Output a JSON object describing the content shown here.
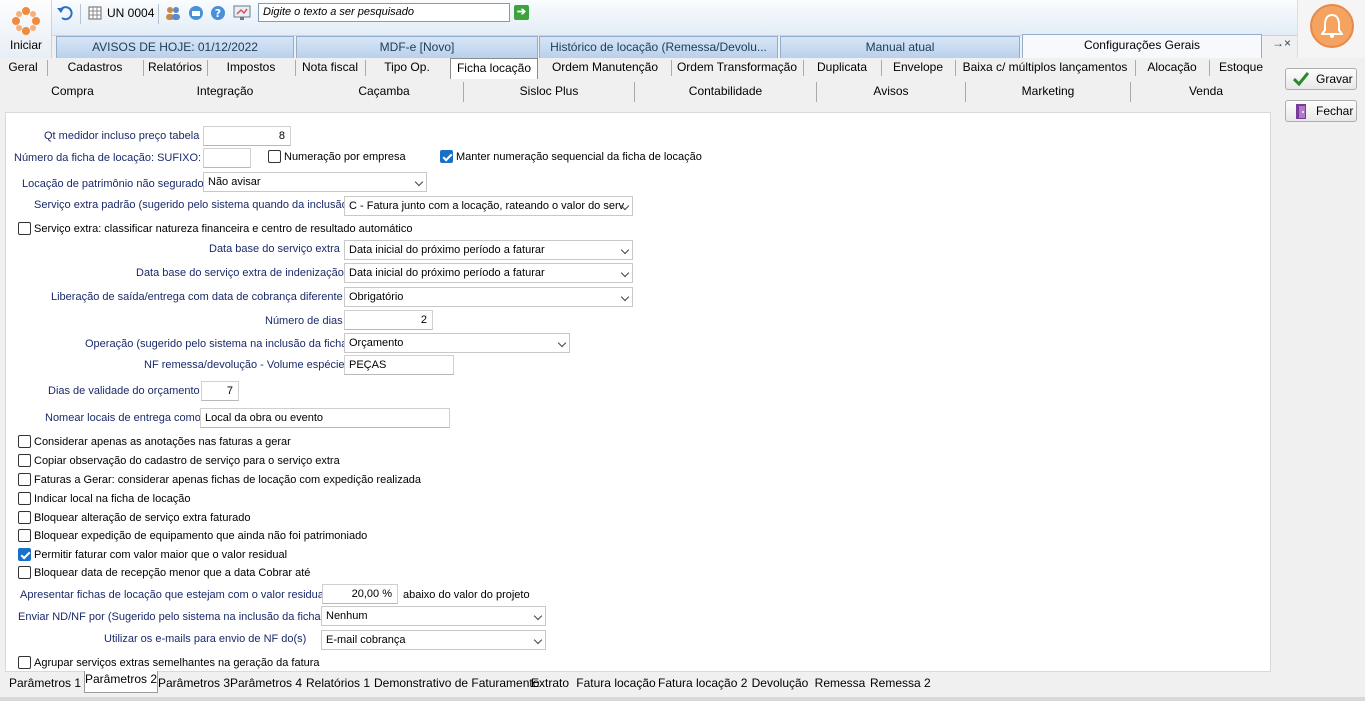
{
  "toolbar": {
    "unit": "UN 0004",
    "search_placeholder": "Digite o texto a ser pesquisado",
    "start": "Iniciar"
  },
  "doc_tabs": [
    "AVISOS DE HOJE: 01/12/2022",
    "MDF-e [Novo]",
    "Histórico de locação (Remessa/Devolu...",
    "Manual atual",
    "Configurações Gerais"
  ],
  "close_all": "→×",
  "tabs1": [
    "Geral",
    "Cadastros",
    "Relatórios",
    "Impostos",
    "Nota fiscal",
    "Tipo Op.",
    "Ficha locação",
    "Ordem Manutenção",
    "Ordem Transformação",
    "Duplicata",
    "Envelope",
    "Baixa c/ múltiplos lançamentos",
    "Alocação",
    "Estoque"
  ],
  "tabs2": [
    "Compra",
    "Integração",
    "Caçamba",
    "Sisloc Plus",
    "Contabilidade",
    "Avisos",
    "Marketing",
    "Venda"
  ],
  "buttons": {
    "save": "Gravar",
    "close": "Fechar"
  },
  "form": {
    "qt_medidor_label": "Qt medidor incluso preço tabela",
    "qt_medidor": "8",
    "numero_ficha_label": "Número da ficha de locação:  SUFIXO:",
    "sufixo": "",
    "numeracao_empresa": "Numeração por empresa",
    "manter_numeracao": "Manter numeração sequencial da ficha de locação",
    "locacao_patrimonio_label": "Locação de patrimônio não segurado",
    "locacao_patrimonio": "Não avisar",
    "servico_extra_padrao_label": "Serviço extra padrão (sugerido pelo sistema quando da inclusão)",
    "servico_extra_padrao": "C - Fatura junto com a locação, rateando o valor do serv",
    "servico_extra_classificar": "Serviço extra: classificar natureza financeira e centro de resultado automático",
    "data_base_label": "Data base do serviço extra",
    "data_base": "Data inicial do próximo período a faturar",
    "data_base_indenizacao_label": "Data base do serviço extra de indenização",
    "data_base_indenizacao": "Data inicial do próximo período a faturar",
    "liberacao_label": "Liberação de saída/entrega com data de cobrança diferente",
    "liberacao": "Obrigatório",
    "numero_dias_label": "Número de dias",
    "numero_dias": "2",
    "operacao_label": "Operação (sugerido pelo sistema na inclusão da ficha)",
    "operacao": "Orçamento",
    "nf_volume_label": "NF remessa/devolução - Volume espécie",
    "nf_volume": "PEÇAS",
    "dias_validade_label": "Dias de validade do orçamento",
    "dias_validade": "7",
    "nomear_locais_label": "Nomear locais de entrega como:",
    "nomear_locais": "Local da obra ou evento",
    "checks": [
      {
        "label": "Considerar apenas as anotações nas faturas a gerar",
        "checked": false
      },
      {
        "label": "Copiar observação do cadastro de serviço para o serviço extra",
        "checked": false
      },
      {
        "label": "Faturas a Gerar: considerar apenas fichas de locação com expedição realizada",
        "checked": false
      },
      {
        "label": "Indicar local na ficha de locação",
        "checked": false
      },
      {
        "label": "Bloquear alteração de serviço extra faturado",
        "checked": false
      },
      {
        "label": "Bloquear expedição de equipamento que ainda não foi patrimoniado",
        "checked": false
      },
      {
        "label": "Permitir faturar com valor maior que o valor residual",
        "checked": true
      },
      {
        "label": "Bloquear data de recepção menor que a data Cobrar até",
        "checked": false
      }
    ],
    "apresentar_label": "Apresentar fichas de locação que estejam com o valor residual",
    "apresentar_valor": "20,00 %",
    "apresentar_suffix": "abaixo do valor do projeto",
    "enviar_nd_label": "Enviar ND/NF por (Sugerido pelo sistema na inclusão da ficha",
    "enviar_nd": "Nenhum",
    "emails_label": "Utilizar os e-mails para envio de NF do(s)",
    "emails": "E-mail cobrança",
    "agrupar": "Agrupar serviços extras semelhantes na geração da fatura"
  },
  "bottom_tabs": [
    "Parâmetros 1",
    "Parâmetros 2",
    "Parâmetros 3",
    "Parâmetros 4",
    "Relatórios 1",
    "Demonstrativo de Faturamento",
    "Extrato",
    "Fatura locação",
    "Fatura locação 2",
    "Devolução",
    "Remessa",
    "Remessa 2"
  ]
}
